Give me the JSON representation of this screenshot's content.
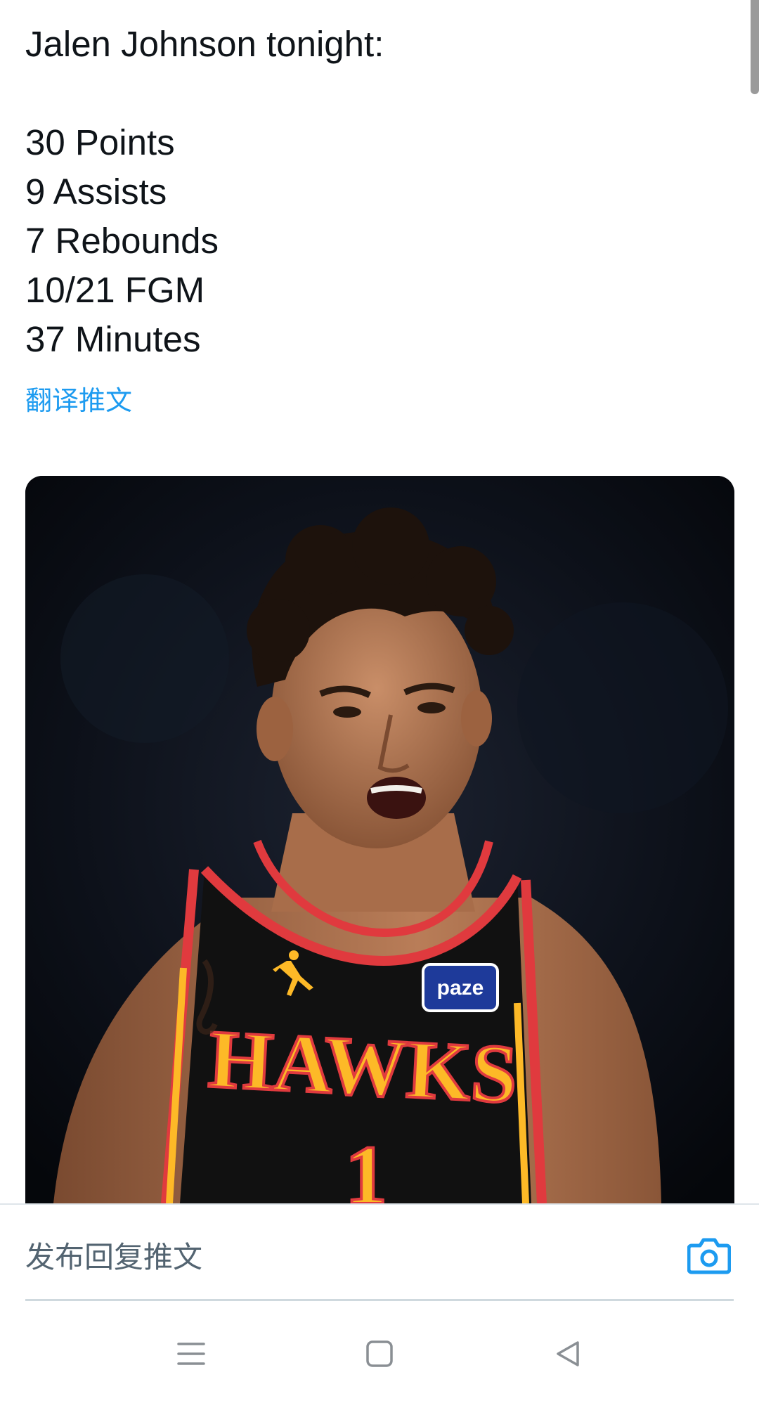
{
  "tweet": {
    "title_line": "Jalen Johnson tonight:",
    "stats": [
      "30 Points",
      "9 Assists",
      "7 Rebounds",
      "10/21 FGM",
      "37 Minutes"
    ],
    "translate_label": "翻译推文"
  },
  "media": {
    "jersey_team": "HAWKS",
    "jersey_number": "1",
    "jersey_sponsor": "paze"
  },
  "reply": {
    "placeholder": "发布回复推文",
    "camera_icon": "camera-icon"
  },
  "navigation": {
    "menu_icon": "menu-icon",
    "home_icon": "home-square-icon",
    "back_icon": "back-triangle-icon"
  },
  "colors": {
    "link": "#1d9bf0",
    "hawks_red": "#e03a3e",
    "hawks_yellow": "#fdb927",
    "jersey_black": "#111111"
  }
}
